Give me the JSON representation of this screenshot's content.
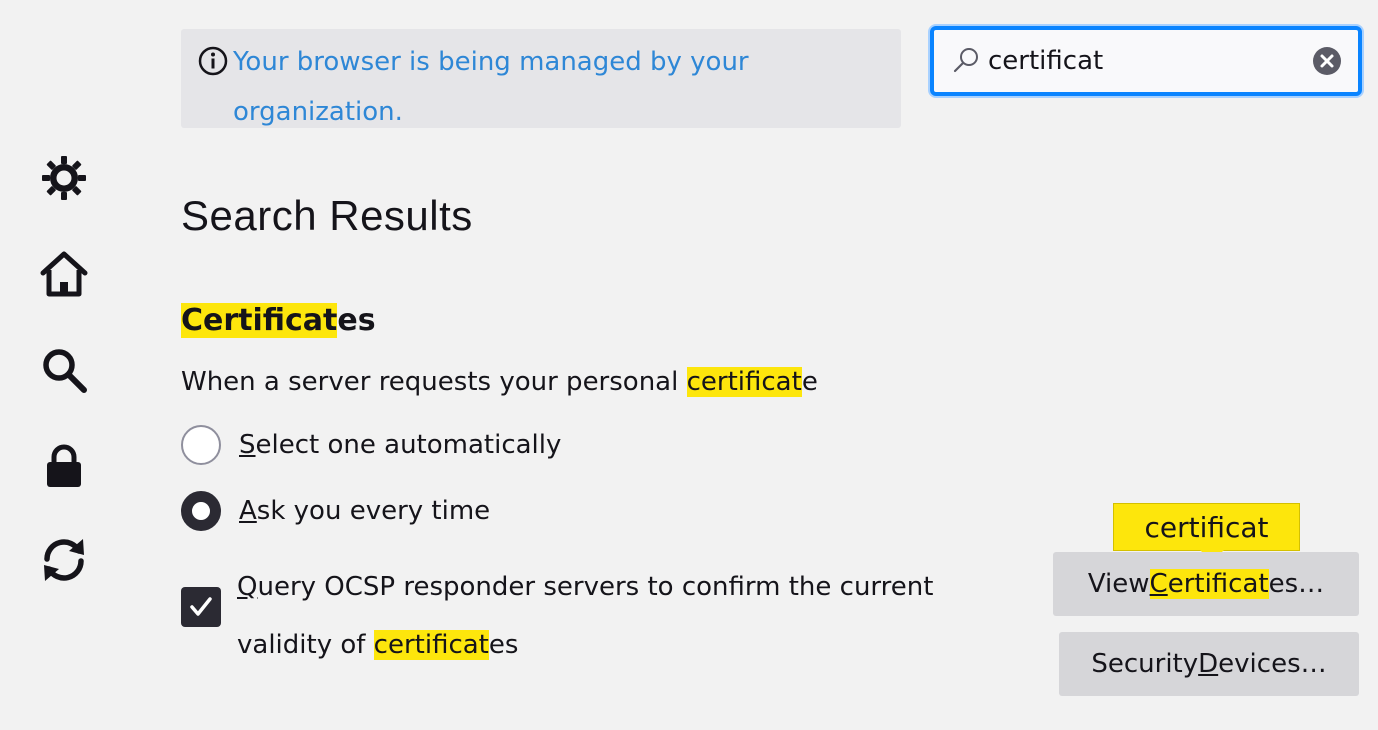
{
  "sidebar": {
    "items": [
      {
        "name": "general",
        "icon": "gear-icon"
      },
      {
        "name": "home",
        "icon": "home-icon"
      },
      {
        "name": "search",
        "icon": "search-icon"
      },
      {
        "name": "privacy",
        "icon": "lock-icon"
      },
      {
        "name": "sync",
        "icon": "sync-icon"
      }
    ]
  },
  "notice": {
    "text": "Your browser is being managed by your organization."
  },
  "search": {
    "value": "certificat",
    "placeholder": ""
  },
  "main": {
    "title": "Search Results",
    "section": {
      "heading_hl": "Certificat",
      "heading_rest": "es",
      "desc_pre": "When a server requests your personal ",
      "desc_hl": "certificat",
      "desc_post": "e",
      "radio1": {
        "access": "S",
        "rest": "elect one automatically",
        "checked": false
      },
      "radio2": {
        "access": "A",
        "rest": "sk you every time",
        "checked": true
      },
      "checkbox": {
        "access": "Q",
        "rest": "uery OCSP responder servers to confirm the current validity of ",
        "hl": "certificat",
        "post": "es",
        "checked": true
      },
      "view_btn": {
        "pre": "View ",
        "access": "C",
        "hl": "ertificat",
        "post": "es…"
      },
      "security_btn": {
        "pre": "Security ",
        "access": "D",
        "post": "evices…"
      },
      "tooltip": "certificat"
    }
  },
  "colors": {
    "highlight": "#fde60c",
    "link": "#2e87d6",
    "focus": "#0a84ff"
  }
}
